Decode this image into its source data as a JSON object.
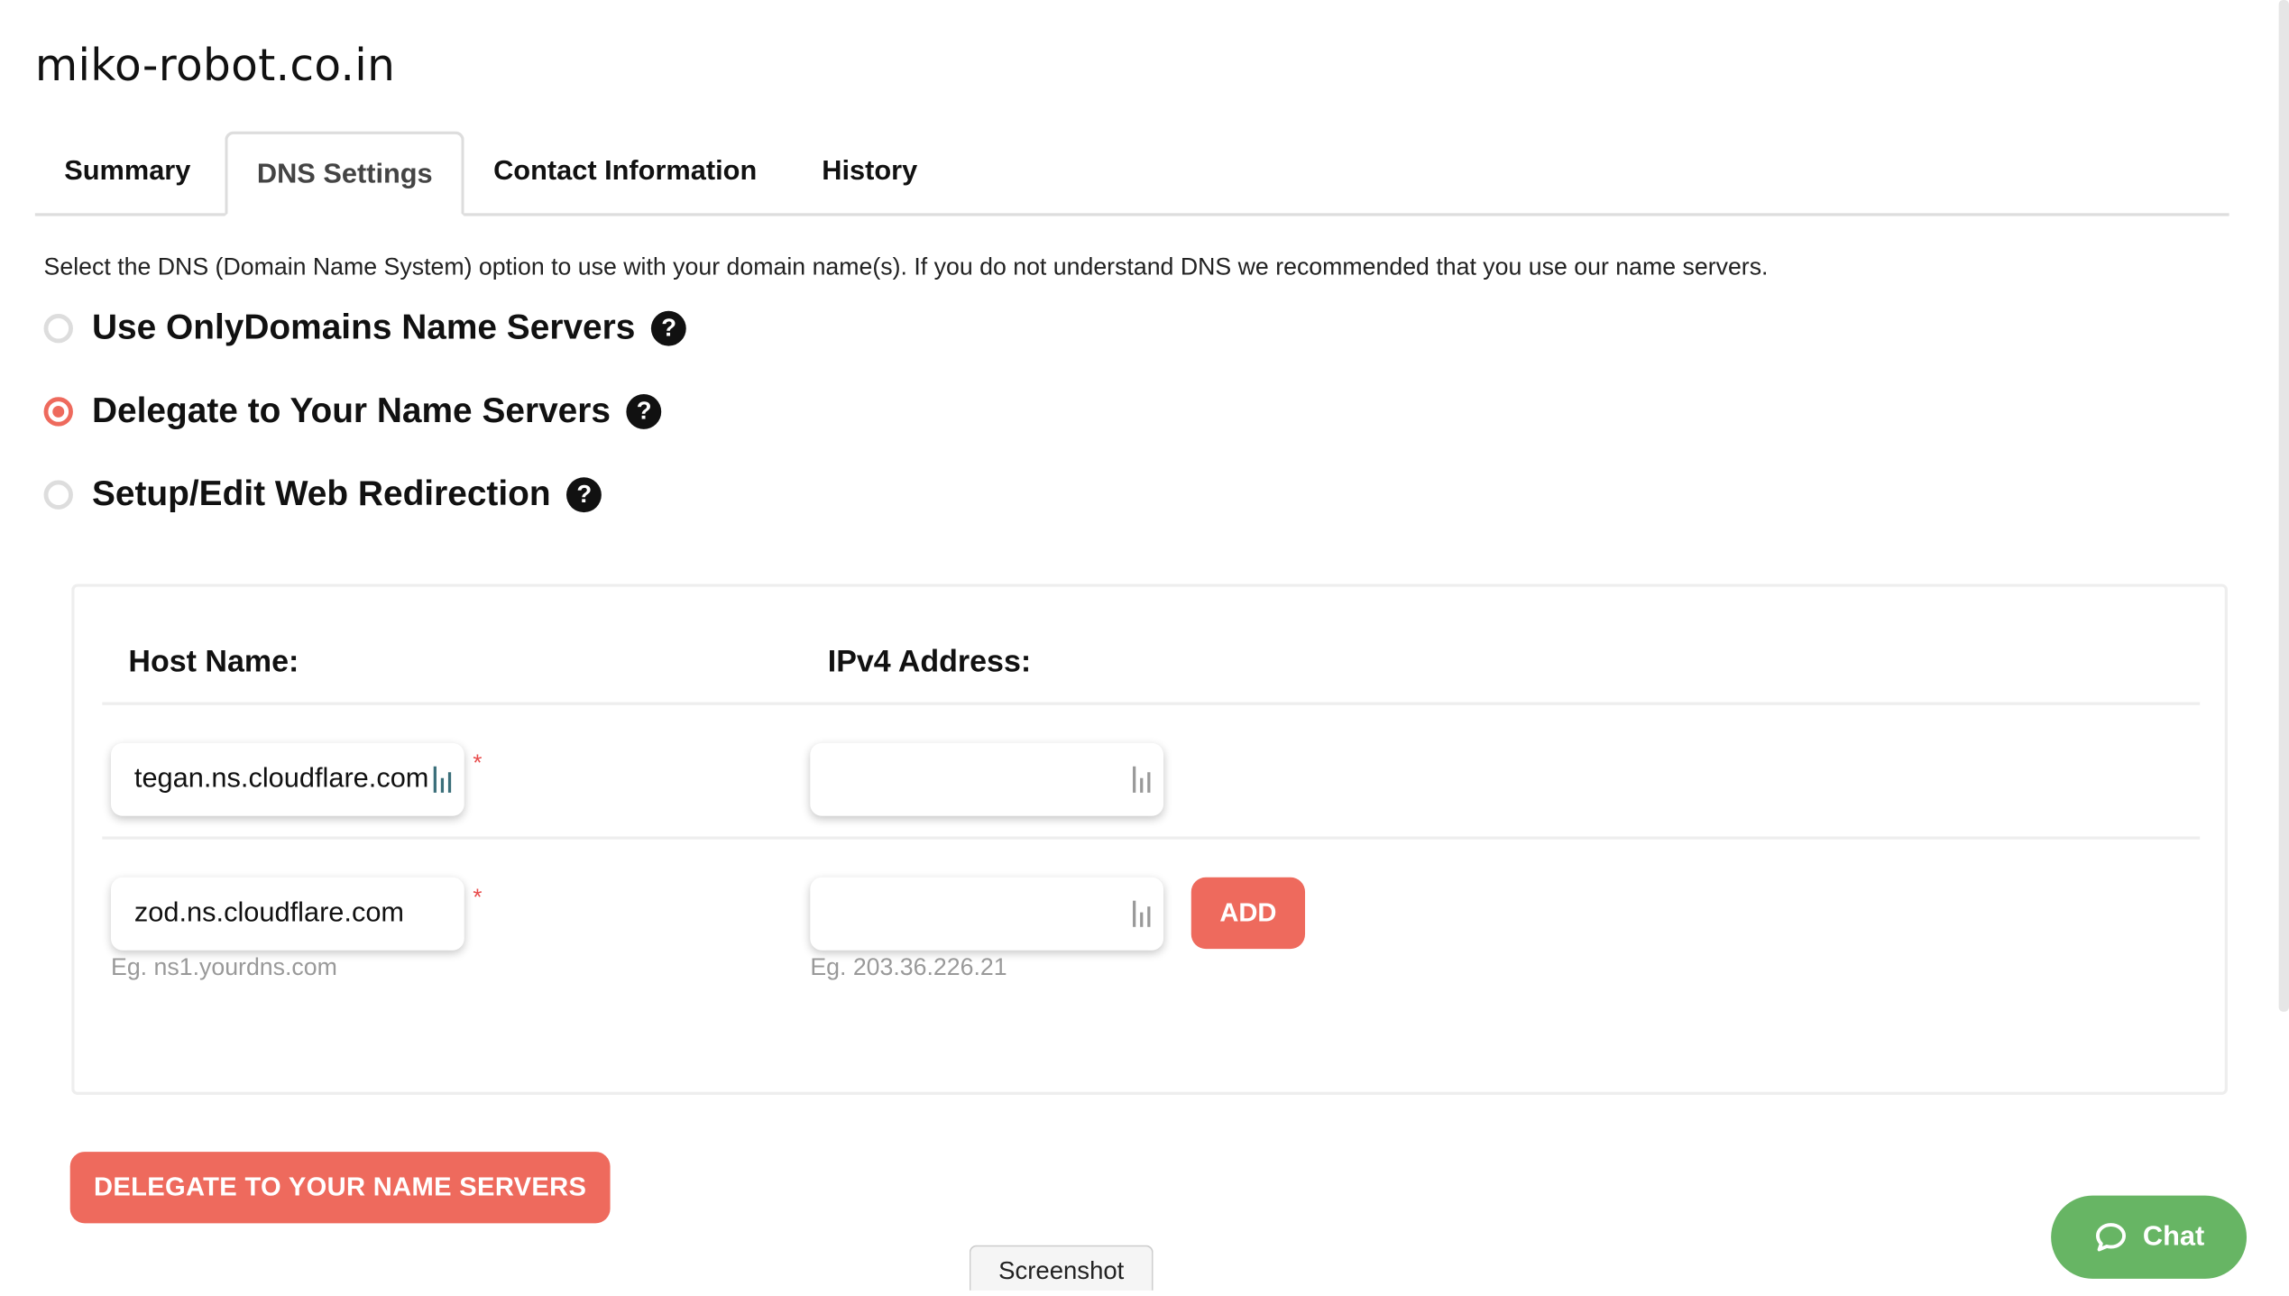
{
  "domain": "miko-robot.co.in",
  "tabs": [
    {
      "label": "Summary",
      "active": false
    },
    {
      "label": "DNS Settings",
      "active": true
    },
    {
      "label": "Contact Information",
      "active": false
    },
    {
      "label": "History",
      "active": false
    }
  ],
  "intro": "Select the DNS (Domain Name System) option to use with your domain name(s). If you do not understand DNS we recommended that you use our name servers.",
  "options": [
    {
      "label": "Use OnlyDomains Name Servers",
      "selected": false
    },
    {
      "label": "Delegate to Your Name Servers",
      "selected": true
    },
    {
      "label": "Setup/Edit Web Redirection",
      "selected": false
    }
  ],
  "table": {
    "host_header": "Host Name:",
    "ip_header": "IPv4 Address:",
    "rows": [
      {
        "host": "tegan.ns.cloudflare.com",
        "ip": ""
      },
      {
        "host": "zod.ns.cloudflare.com",
        "ip": ""
      }
    ],
    "required_mark": "*",
    "host_hint": "Eg. ns1.yourdns.com",
    "ip_hint": "Eg. 203.36.226.21",
    "add_label": "ADD"
  },
  "submit_label": "DELEGATE TO YOUR NAME SERVERS",
  "screenshot_label": "Screenshot",
  "chat_label": "Chat",
  "help_glyph": "?",
  "colors": {
    "accent": "#ee6a5d",
    "chat": "#67b564"
  }
}
